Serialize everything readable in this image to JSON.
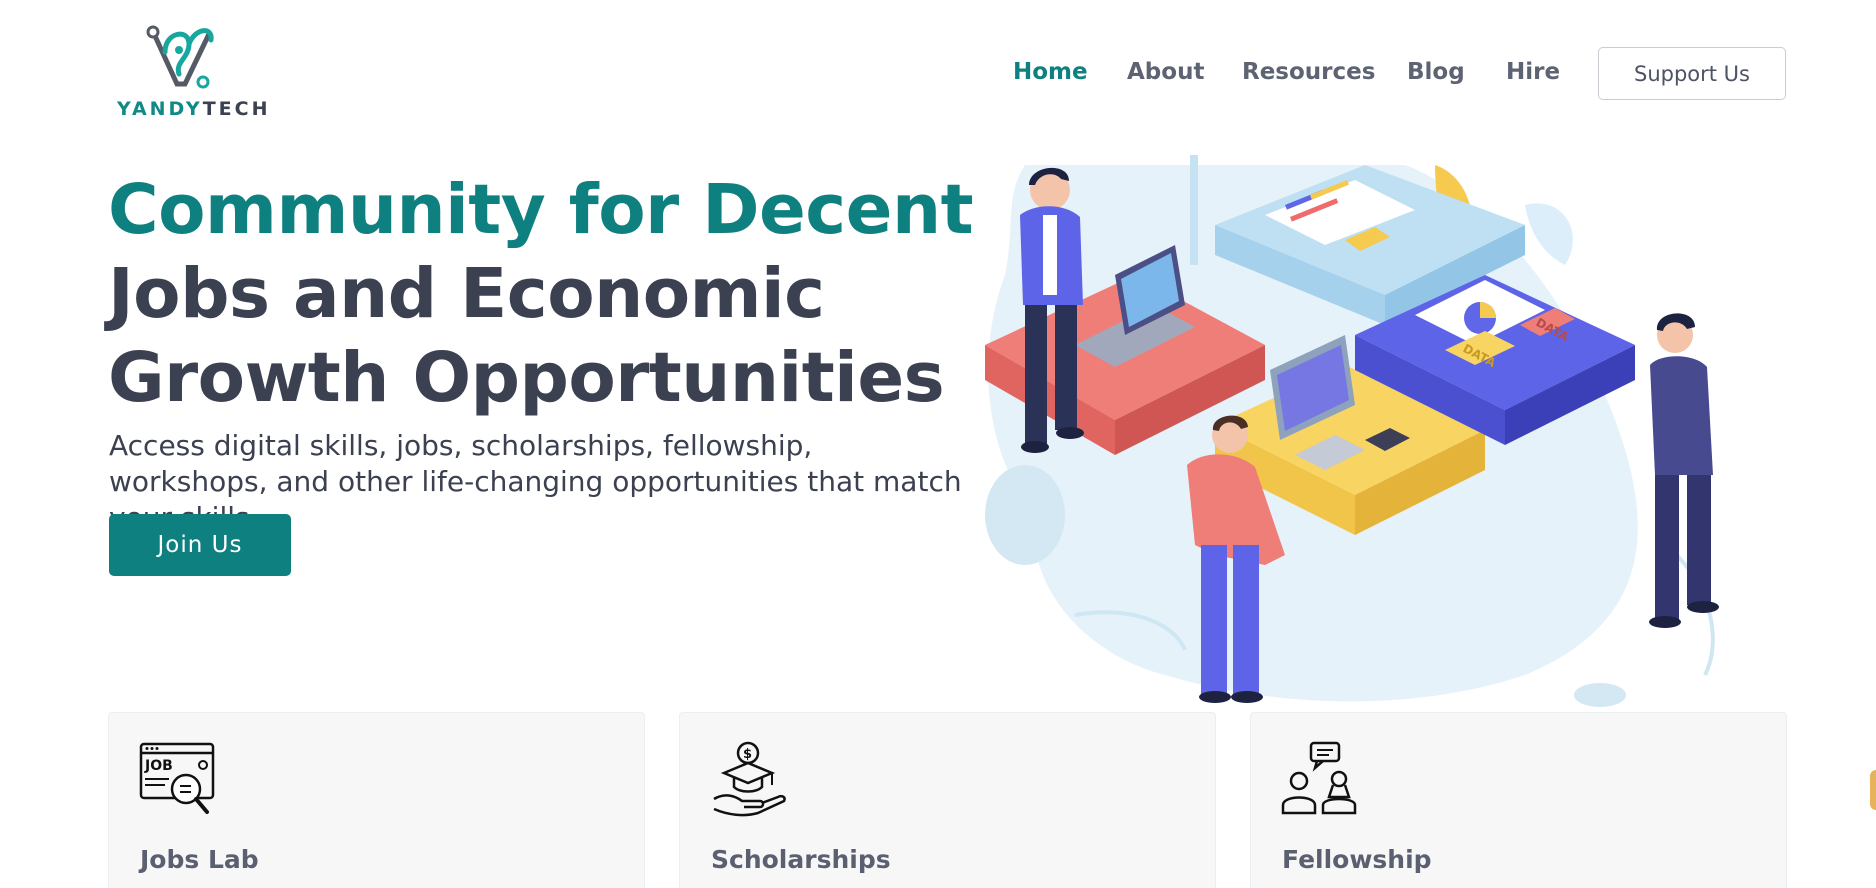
{
  "brand": {
    "name_part1": "YANDY",
    "name_part2": "TECH",
    "logo_icon": "yandytech-logo-icon"
  },
  "nav": {
    "items": [
      {
        "label": "Home",
        "active": true
      },
      {
        "label": "About",
        "active": false
      },
      {
        "label": "Resources",
        "active": false
      },
      {
        "label": "Blog",
        "active": false
      },
      {
        "label": "Hire",
        "active": false
      }
    ],
    "support_label": "Support Us"
  },
  "hero": {
    "title_line1": "Community for Decent",
    "title_line2": "Jobs and Economic",
    "title_line3": "Growth Opportunities",
    "subtitle": "Access digital skills, jobs, scholarships, fellowship, workshops, and other life-changing opportunities that match your skills.",
    "cta_label": "Join Us",
    "illustration": "team-puzzle-illustration",
    "illustration_tags": [
      "DATA",
      "DATA"
    ]
  },
  "cards": [
    {
      "label": "Jobs Lab",
      "icon": "job-search-icon"
    },
    {
      "label": "Scholarships",
      "icon": "scholarship-icon"
    },
    {
      "label": "Fellowship",
      "icon": "fellowship-icon"
    }
  ],
  "colors": {
    "primary": "#0f8080",
    "text": "#3b4150",
    "muted": "#5d6372",
    "card_bg": "#f7f7f8"
  }
}
